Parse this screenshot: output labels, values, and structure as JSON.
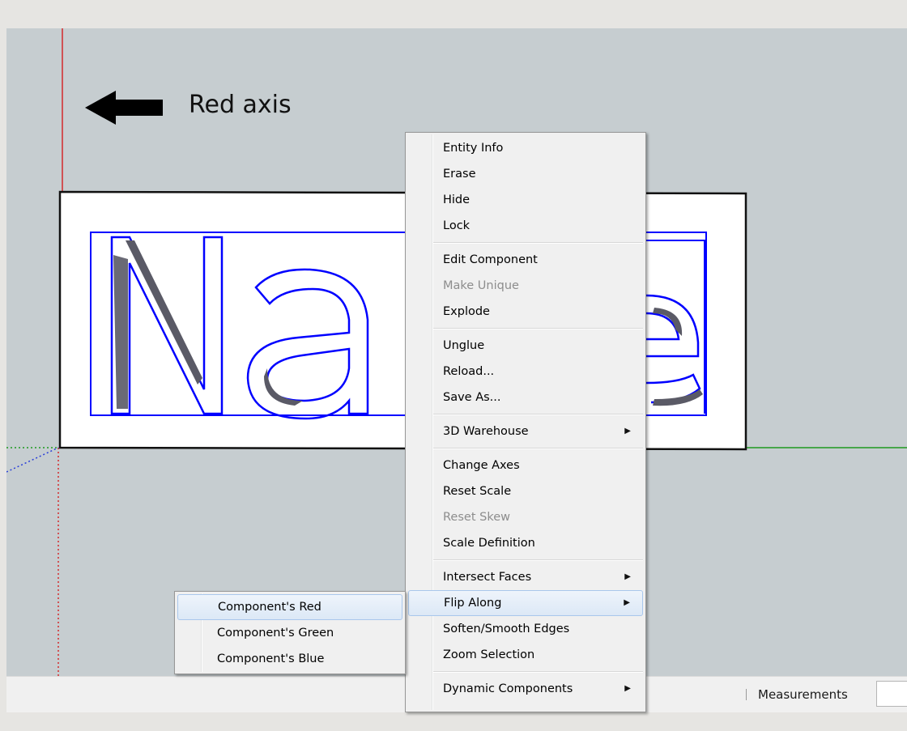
{
  "viewport": {
    "axis_label": "Red axis",
    "model_text": "Name",
    "colors": {
      "background": "#c6cdd0",
      "red_axis": "#d42a2a",
      "green_axis": "#1f9a1f",
      "blue_axis": "#2a3fd8",
      "selection": "#0000ff"
    }
  },
  "status_bar": {
    "measurements_label": "Measurements",
    "measurements_value": ""
  },
  "context_menu": {
    "groups": [
      [
        {
          "label": "Entity Info"
        },
        {
          "label": "Erase"
        },
        {
          "label": "Hide"
        },
        {
          "label": "Lock"
        }
      ],
      [
        {
          "label": "Edit Component"
        },
        {
          "label": "Make Unique",
          "disabled": true
        },
        {
          "label": "Explode"
        }
      ],
      [
        {
          "label": "Unglue"
        },
        {
          "label": "Reload..."
        },
        {
          "label": "Save As..."
        }
      ],
      [
        {
          "label": "3D Warehouse",
          "submenu": true
        }
      ],
      [
        {
          "label": "Change Axes"
        },
        {
          "label": "Reset Scale"
        },
        {
          "label": "Reset Skew",
          "disabled": true
        },
        {
          "label": "Scale Definition"
        }
      ],
      [
        {
          "label": "Intersect Faces",
          "submenu": true
        },
        {
          "label": "Flip Along",
          "submenu": true,
          "highlighted": true
        },
        {
          "label": "Soften/Smooth Edges"
        },
        {
          "label": "Zoom Selection"
        }
      ],
      [
        {
          "label": "Dynamic Components",
          "submenu": true
        }
      ]
    ]
  },
  "flip_submenu": {
    "items": [
      {
        "label": "Component's Red",
        "highlighted": true
      },
      {
        "label": "Component's Green"
      },
      {
        "label": "Component's Blue"
      }
    ]
  }
}
